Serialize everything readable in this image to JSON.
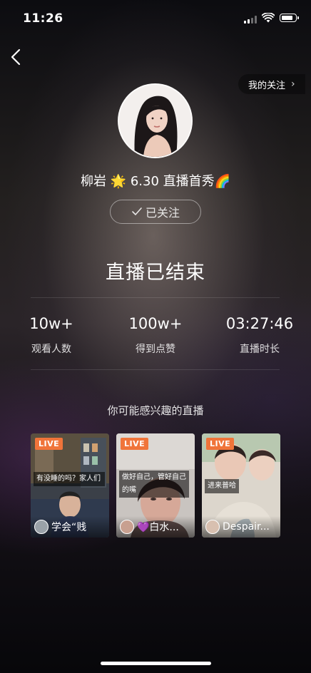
{
  "status_bar": {
    "time": "11:26"
  },
  "header": {
    "back_icon": "chevron-left-icon",
    "my_follows_label": "我的关注",
    "chevron_icon": "chevron-right-icon"
  },
  "host": {
    "name": "柳岩",
    "title": "🌟 6.30 直播首秀🌈",
    "follow_button_label": "已关注"
  },
  "stream": {
    "ended_title": "直播已结束",
    "stats": [
      {
        "value": "10w+",
        "label": "观看人数"
      },
      {
        "value": "100w+",
        "label": "得到点赞"
      },
      {
        "value": "03:27:46",
        "label": "直播时长"
      }
    ]
  },
  "recommend": {
    "title": "你可能感兴趣的直播",
    "badge_label": "LIVE",
    "cards": [
      {
        "caption": "有没睡的吗？家人们",
        "name": "学会“贱"
      },
      {
        "caption": "做好自己，管好自己的嘴",
        "name": "💜白水..."
      },
      {
        "caption": "进来普哈",
        "name": "Despair..."
      }
    ]
  },
  "colors": {
    "live_badge": "#f0743a"
  }
}
